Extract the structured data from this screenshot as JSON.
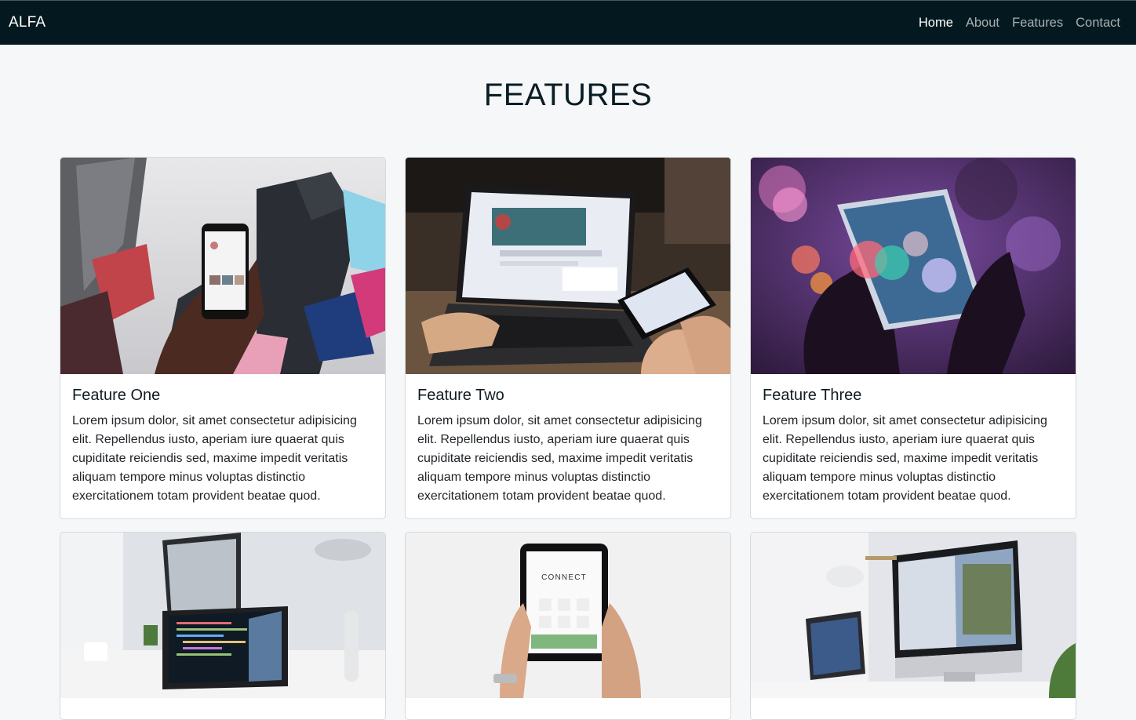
{
  "nav": {
    "brand": "ALFA",
    "links": [
      {
        "label": "Home",
        "active": true
      },
      {
        "label": "About",
        "active": false
      },
      {
        "label": "Features",
        "active": false
      },
      {
        "label": "Contact",
        "active": false
      }
    ]
  },
  "page": {
    "title": "FEATURES"
  },
  "cards": [
    {
      "title": "Feature One",
      "text": "Lorem ipsum dolor, sit amet consectetur adipisicing elit. Repellendus iusto, aperiam iure quaerat quis cupiditate reiciendis sed, maxime impedit veritatis aliquam tempore minus voluptas distinctio exercitationem totam provident beatae quod.",
      "image": "phone-in-city-photo"
    },
    {
      "title": "Feature Two",
      "text": "Lorem ipsum dolor, sit amet consectetur adipisicing elit. Repellendus iusto, aperiam iure quaerat quis cupiditate reiciendis sed, maxime impedit veritatis aliquam tempore minus voluptas distinctio exercitationem totam provident beatae quod.",
      "image": "laptop-and-phone-photo"
    },
    {
      "title": "Feature Three",
      "text": "Lorem ipsum dolor, sit amet consectetur adipisicing elit. Repellendus iusto, aperiam iure quaerat quis cupiditate reiciendis sed, maxime impedit veritatis aliquam tempore minus voluptas distinctio exercitationem totam provident beatae quod.",
      "image": "phone-bokeh-photo"
    },
    {
      "image": "laptop-code-desk-photo"
    },
    {
      "image": "tablet-connect-photo",
      "tablet_text": "CONNECT"
    },
    {
      "image": "imac-desk-photo"
    }
  ],
  "colors": {
    "navbar": "#04191f",
    "background": "#f6f7f9",
    "nav_active": "#ffffff",
    "nav_inactive": "#a8b0b3"
  }
}
